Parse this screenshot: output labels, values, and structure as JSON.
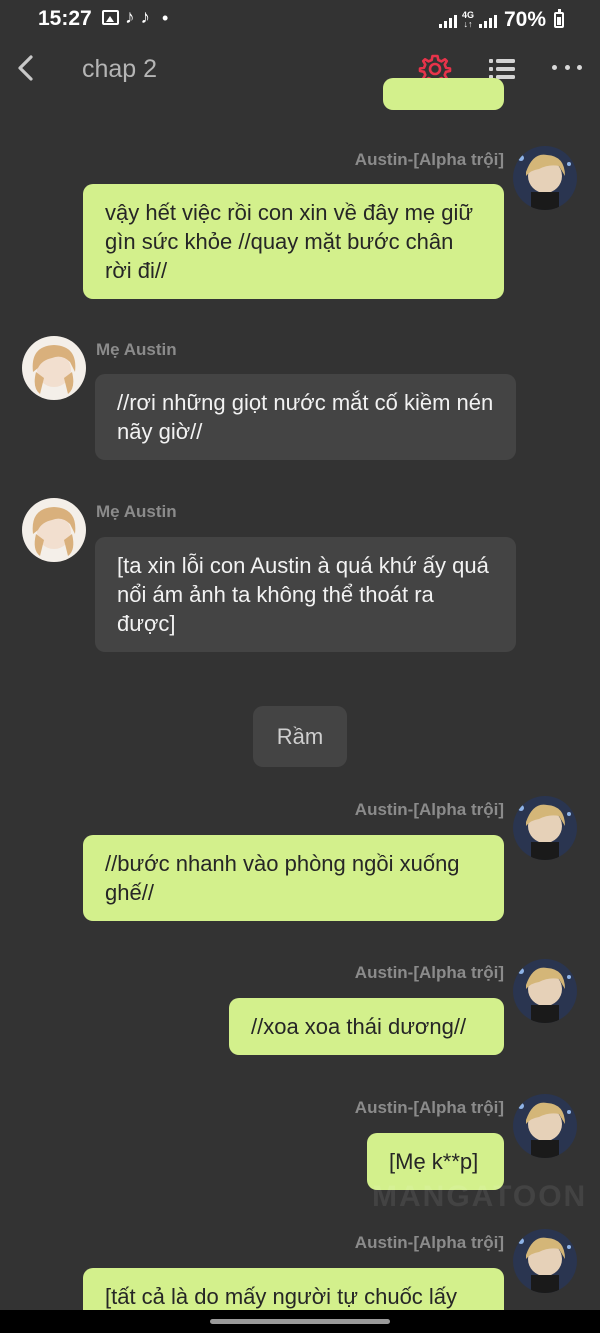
{
  "status_bar": {
    "time": "15:27",
    "network": "4G",
    "battery": "70%"
  },
  "header": {
    "title": "chap 2",
    "icons": [
      "back-icon",
      "gear-icon",
      "list-icon",
      "more-icon"
    ],
    "accent_color": "#e8334a"
  },
  "colors": {
    "background": "#333333",
    "my_bubble": "#d3f08c",
    "their_bubble": "#444444",
    "name_text": "#8b8b8b"
  },
  "messages": [
    {
      "sender": "Austin-[Alpha trội]",
      "side": "right",
      "text": "vậy hết việc rồi con xin về đây mẹ giữ gìn sức khỏe //quay mặt bước chân rời đi//"
    },
    {
      "sender": "Mẹ Austin",
      "side": "left",
      "text": "//rơi những giọt nước mắt cố kiềm nén nãy giờ//"
    },
    {
      "sender": "Mẹ Austin",
      "side": "left",
      "text": "[ta xin lỗi con Austin à quá khứ ấy quá nổi ám ảnh ta không thể thoát ra được]"
    },
    {
      "sender": "",
      "side": "center",
      "text": "Rầm"
    },
    {
      "sender": "Austin-[Alpha trội]",
      "side": "right",
      "text": "//bước nhanh vào phòng ngồi xuống ghế//"
    },
    {
      "sender": "Austin-[Alpha trội]",
      "side": "right",
      "text": "//xoa xoa thái dương//"
    },
    {
      "sender": "Austin-[Alpha trội]",
      "side": "right",
      "text": "[Mẹ k**p]"
    },
    {
      "sender": "Austin-[Alpha trội]",
      "side": "right",
      "text": "[tất cả là do mấy người tự chuốc lấy"
    }
  ],
  "watermark": "MANGATOON"
}
